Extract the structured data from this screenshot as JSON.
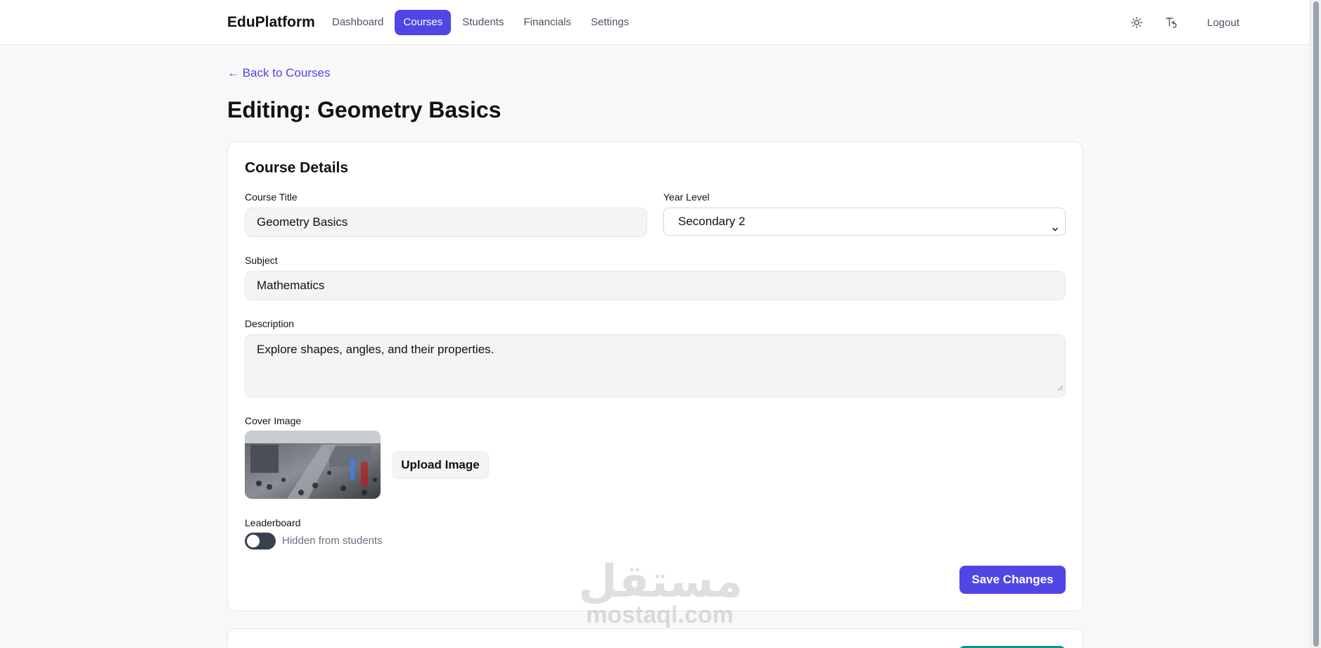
{
  "app": {
    "brand": "EduPlatform"
  },
  "nav": {
    "items": [
      {
        "label": "Dashboard"
      },
      {
        "label": "Courses",
        "active": true
      },
      {
        "label": "Students"
      },
      {
        "label": "Financials"
      },
      {
        "label": "Settings"
      }
    ],
    "theme_icon": "sun-icon",
    "translate_icon": "translate-icon",
    "logout_label": "Logout"
  },
  "page": {
    "back_link": "← Back to Courses",
    "title": "Editing: Geometry Basics"
  },
  "course_details": {
    "heading": "Course Details",
    "course_title_label": "Course Title",
    "course_title_value": "Geometry Basics",
    "year_level_label": "Year Level",
    "year_level_value": "Secondary 2",
    "subject_label": "Subject",
    "subject_value": "Mathematics",
    "description_label": "Description",
    "description_value": "Explore shapes, angles, and their properties.",
    "cover_image_label": "Cover Image",
    "upload_button": "Upload Image",
    "leaderboard_label": "Leaderboard",
    "leaderboard_enabled": false,
    "leaderboard_status": "Hidden from students",
    "save_button": "Save Changes"
  },
  "watermark": {
    "arabic": "مستقل",
    "latin": "mostaql.com"
  },
  "colors": {
    "accent": "#4f46e5",
    "secondary_button": "#0d9488",
    "toggle_off": "#374151"
  }
}
